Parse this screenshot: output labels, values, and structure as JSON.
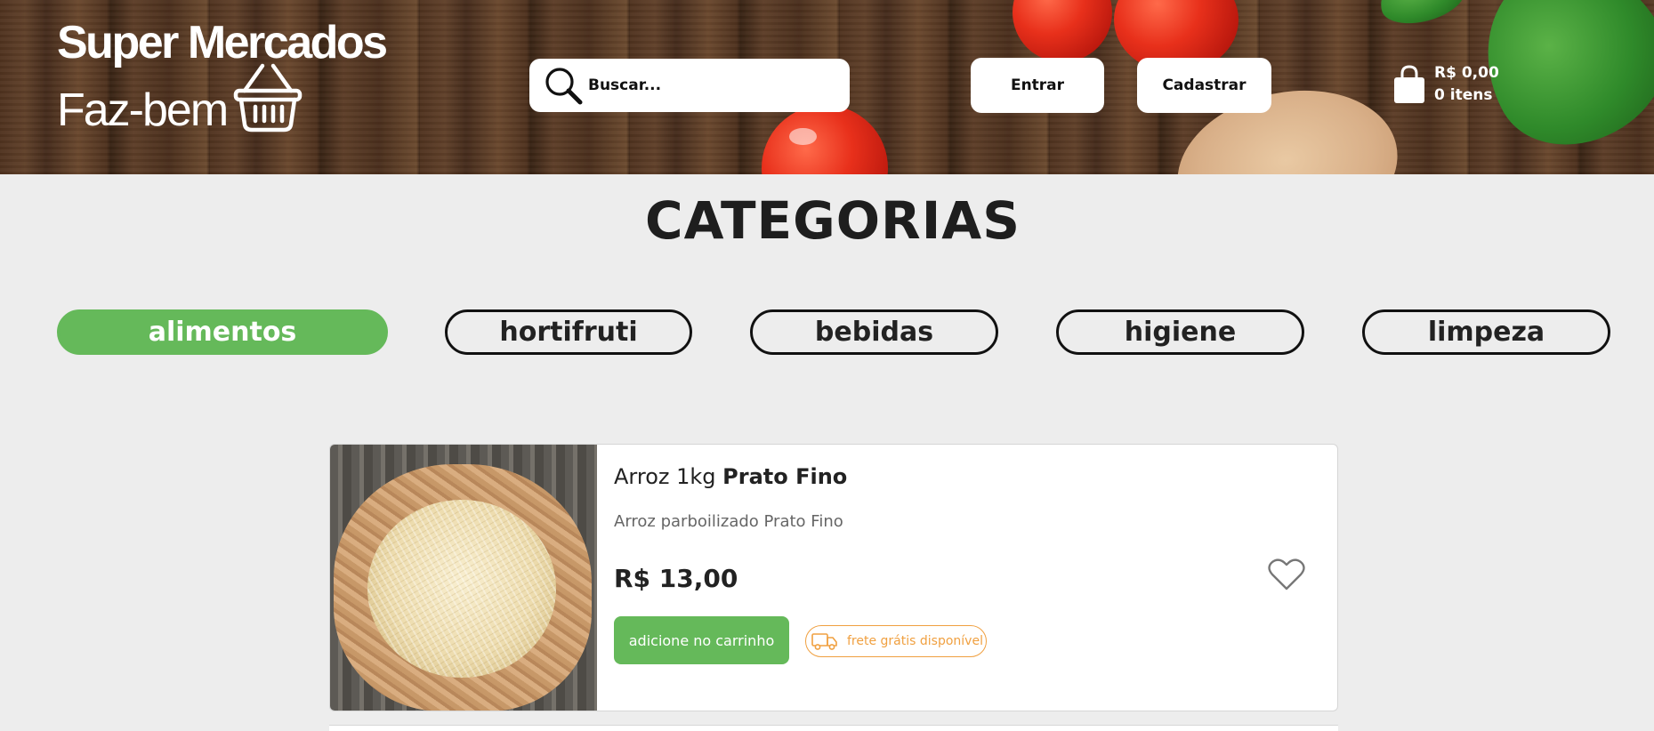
{
  "brand": {
    "line1": "Super Mercados",
    "line2": "Faz-bem"
  },
  "search": {
    "placeholder": "Buscar...",
    "icon": "search-icon"
  },
  "header": {
    "login_label": "Entrar",
    "signup_label": "Cadastrar"
  },
  "cart": {
    "total": "R$ 0,00",
    "items": "0 itens",
    "icon": "shopping-bag-icon"
  },
  "categories": {
    "title": "CATEGORIAS",
    "items": [
      {
        "label": "alimentos",
        "active": true
      },
      {
        "label": "hortifruti",
        "active": false
      },
      {
        "label": "bebidas",
        "active": false
      },
      {
        "label": "higiene",
        "active": false
      },
      {
        "label": "limpeza",
        "active": false
      }
    ],
    "active_color": "#65b95a"
  },
  "product": {
    "name": "Arroz 1kg",
    "brand": "Prato Fino",
    "description": "Arroz parboilizado Prato Fino",
    "price": "R$ 13,00",
    "add_label": "adicione no carrinho",
    "shipping_label": "frete grátis disponível",
    "shipping_icon": "truck-icon",
    "favorite_icon": "heart-icon"
  },
  "colors": {
    "accent_green": "#65b95a",
    "shipping_orange": "#f0a040",
    "background": "#ededed"
  }
}
